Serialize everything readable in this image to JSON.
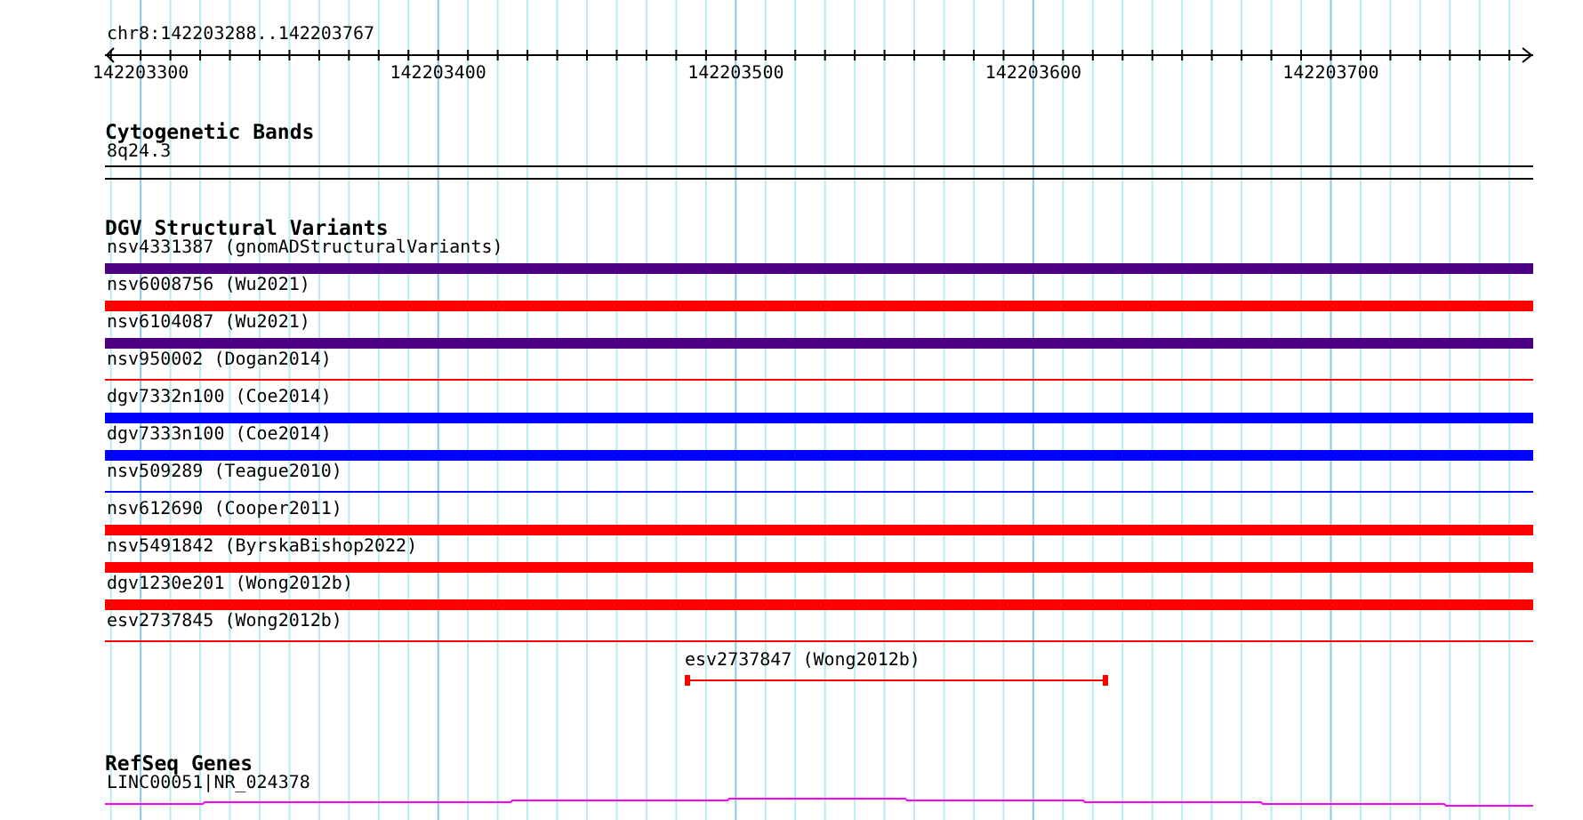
{
  "ruler": {
    "range": "chr8:142203288..142203767",
    "ticks": [
      "142203300",
      "142203400",
      "142203500",
      "142203600",
      "142203700"
    ]
  },
  "cytoband_track": {
    "title": "Cytogenetic Bands",
    "band": "8q24.3"
  },
  "variant_track": {
    "title": "DGV Structural Variants",
    "variants": [
      {
        "label": "nsv4331387 (gnomADStructuralVariants)",
        "kind": "thick",
        "color": "#4b0082"
      },
      {
        "label": "nsv6008756 (Wu2021)",
        "kind": "thick",
        "color": "#ff0000"
      },
      {
        "label": "nsv6104087 (Wu2021)",
        "kind": "thick",
        "color": "#4b0082"
      },
      {
        "label": "nsv950002 (Dogan2014)",
        "kind": "thin",
        "color": "#ff0000"
      },
      {
        "label": "dgv7332n100 (Coe2014)",
        "kind": "thick",
        "color": "#0000ff"
      },
      {
        "label": "dgv7333n100 (Coe2014)",
        "kind": "thick",
        "color": "#0000ff"
      },
      {
        "label": "nsv509289 (Teague2010)",
        "kind": "thin",
        "color": "#0000ff"
      },
      {
        "label": "nsv612690 (Cooper2011)",
        "kind": "thick",
        "color": "#ff0000"
      },
      {
        "label": "nsv5491842 (ByrskaBishop2022)",
        "kind": "thick",
        "color": "#ff0000"
      },
      {
        "label": "dgv1230e201 (Wong2012b)",
        "kind": "thick",
        "color": "#ff0000"
      },
      {
        "label": "esv2737845 (Wong2012b)",
        "kind": "thin",
        "color": "#ff0000"
      },
      {
        "label": "esv2737847 (Wong2012b)",
        "kind": "partial",
        "color": "#ff0000"
      }
    ]
  },
  "gene_track": {
    "title": "RefSeq Genes",
    "gene": "LINC00051|NR_024378"
  }
}
